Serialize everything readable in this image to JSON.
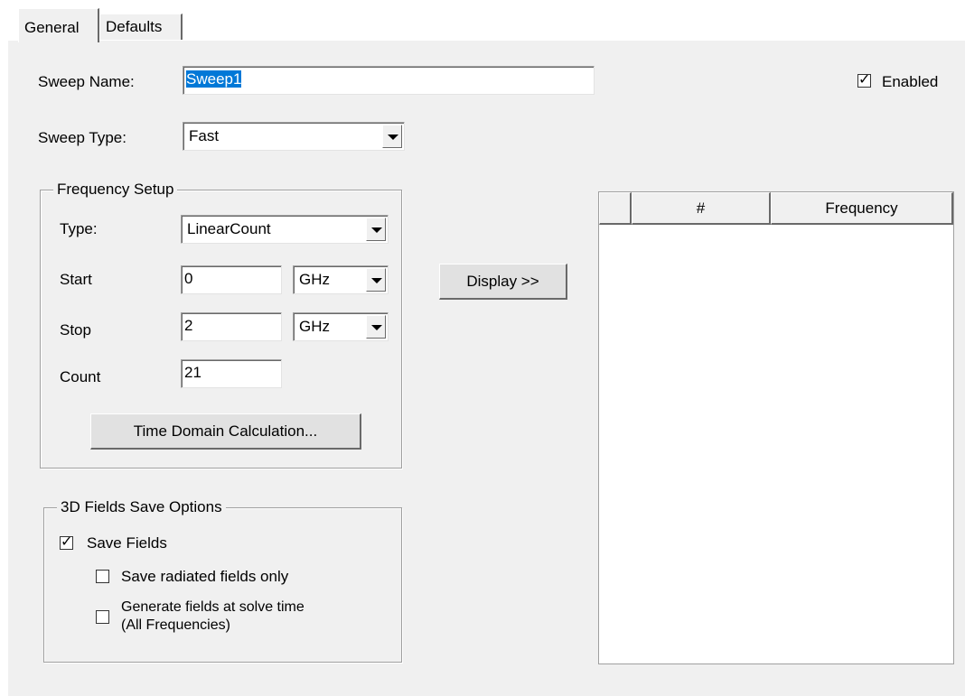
{
  "tabs": [
    {
      "label": "General",
      "active": true
    },
    {
      "label": "Defaults",
      "active": false
    }
  ],
  "sweep": {
    "name_label": "Sweep Name:",
    "name_value": "Sweep1",
    "enabled_label": "Enabled",
    "enabled_checked": true,
    "type_label": "Sweep Type:",
    "type_value": "Fast"
  },
  "frequency_setup": {
    "title": "Frequency Setup",
    "type_label": "Type:",
    "type_value": "LinearCount",
    "start_label": "Start",
    "start_value": "0",
    "start_unit": "GHz",
    "stop_label": "Stop",
    "stop_value": "2",
    "stop_unit": "GHz",
    "count_label": "Count",
    "count_value": "21",
    "time_domain_button": "Time Domain Calculation..."
  },
  "display_button": "Display >>",
  "table": {
    "columns": [
      "",
      "#",
      "Frequency"
    ],
    "rows": []
  },
  "fields_save": {
    "title": "3D Fields Save Options",
    "save_fields_label": "Save Fields",
    "save_fields_checked": true,
    "radiated_only_label": "Save radiated fields only",
    "radiated_only_checked": false,
    "generate_label_line1": "Generate fields at solve time",
    "generate_label_line2": "(All Frequencies)",
    "generate_checked": false
  },
  "icons": {
    "check": "checkmark-icon",
    "dropdown": "chevron-down-icon"
  }
}
